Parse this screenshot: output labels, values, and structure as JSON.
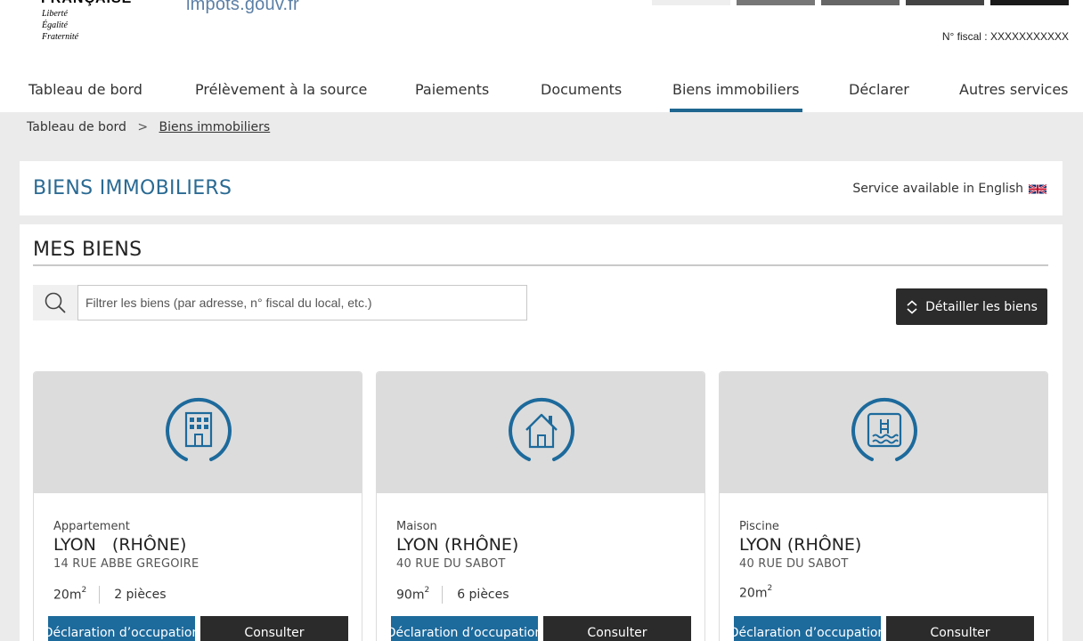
{
  "header": {
    "logo_top": "FRANÇAISE",
    "motto": [
      "Liberté",
      "Égalité",
      "Fraternité"
    ],
    "site_name": "impots.gouv.fr",
    "top_button_colors": [
      "#eeeeee",
      "#777777",
      "#666666",
      "#444444",
      "#1a1a1a"
    ],
    "fiscal_label": "N° fiscal : XXXXXXXXXXX"
  },
  "nav": {
    "items": [
      {
        "label": "Tableau de bord"
      },
      {
        "label": "Prélèvement à la source"
      },
      {
        "label": "Paiements"
      },
      {
        "label": "Documents"
      },
      {
        "label": "Biens immobiliers",
        "active": true
      },
      {
        "label": "Déclarer"
      },
      {
        "label": "Autres services"
      }
    ]
  },
  "breadcrumb": {
    "home": "Tableau de bord",
    "separator": ">",
    "current": "Biens immobiliers"
  },
  "title_panel": {
    "title": "BIENS IMMOBILIERS",
    "english_link": "Service available in English"
  },
  "main": {
    "heading": "MES BIENS",
    "search": {
      "placeholder": "Filtrer les biens (par adresse, n° fiscal du local, etc.)",
      "value": ""
    },
    "detail_button": "Détailler les biens"
  },
  "cards": [
    {
      "icon": "building-icon",
      "type": "Appartement",
      "city": "LYON   (RHÔNE)",
      "address": "14 RUE ABBE GREGOIRE",
      "surface": "20m",
      "surface_unit_sup": "2",
      "rooms": "2 pièces",
      "btn_declaration": "Déclaration d’occupation",
      "btn_consulter": "Consulter"
    },
    {
      "icon": "house-icon",
      "type": "Maison",
      "city": "LYON (RHÔNE)",
      "address": "40 RUE DU SABOT",
      "surface": "90m",
      "surface_unit_sup": "2",
      "rooms": "6 pièces",
      "btn_declaration": "Déclaration d’occupation",
      "btn_consulter": "Consulter"
    },
    {
      "icon": "pool-icon",
      "type": "Piscine",
      "city": "LYON (RHÔNE)",
      "address": "40 RUE DU SABOT",
      "surface": "20m",
      "surface_unit_sup": "2",
      "rooms": "",
      "btn_declaration": "Déclaration d’occupation",
      "btn_consulter": "Consulter"
    }
  ],
  "colors": {
    "accent": "#1f6690",
    "title_blue": "#2a6a93",
    "dark_button": "#2b2b2b",
    "declaration_button": "#1d6a9c",
    "icon_blue": "#1d6a9c"
  }
}
